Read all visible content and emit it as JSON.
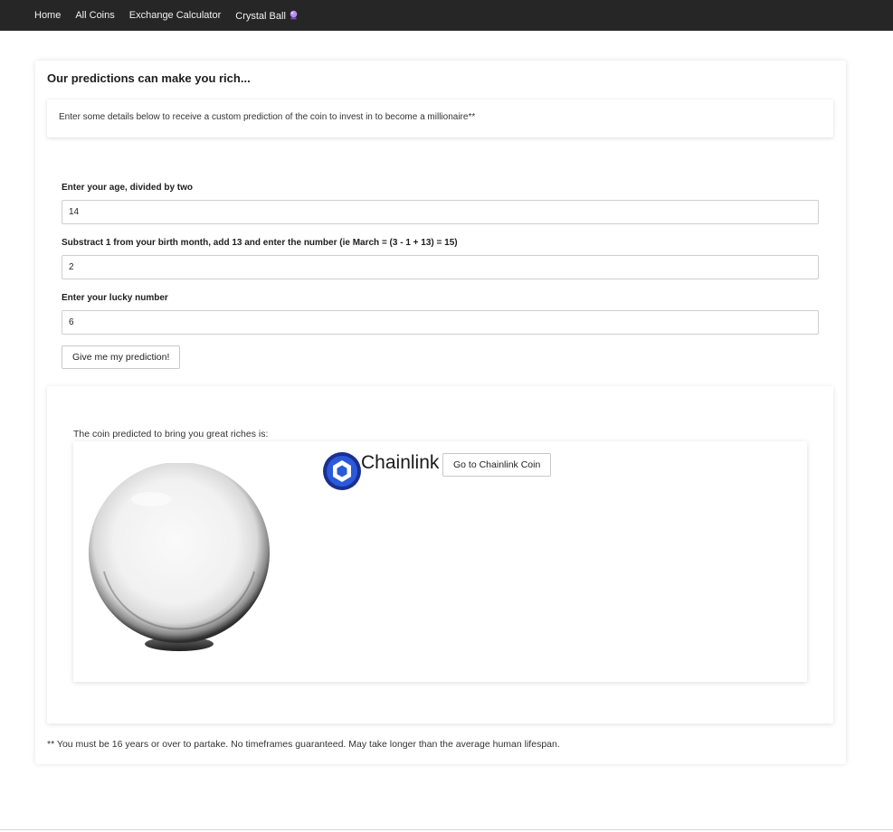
{
  "nav": {
    "items": [
      {
        "label": "Home"
      },
      {
        "label": "All Coins"
      },
      {
        "label": "Exchange Calculator"
      },
      {
        "label": "Crystal Ball",
        "icon": "crystal-ball-emoji"
      }
    ]
  },
  "main": {
    "heading": "Our predictions can make you rich...",
    "intro": "Enter some details below to receive a custom prediction of the coin to invest in to become a millionaire**"
  },
  "form": {
    "age": {
      "label": "Enter your age, divided by two",
      "value": "14"
    },
    "month": {
      "label": "Substract 1 from your birth month, add 13 and enter the number (ie March = (3 - 1 + 13) = 15)",
      "value": "2"
    },
    "lucky": {
      "label": "Enter your lucky number",
      "value": "6"
    },
    "submit_label": "Give me my prediction!"
  },
  "result": {
    "caption": "The coin predicted to bring you great riches is:",
    "coin_name": "Chainlink",
    "coin_icon": "chainlink-logo",
    "go_label": "Go to Chainlink Coin",
    "image": "crystal-ball-image"
  },
  "disclaimer": "** You must be 16 years or over to partake. No timeframes guaranteed. May take longer than the average human lifespan.",
  "colors": {
    "navbar": "#262626",
    "chainlink_blue": "#2A5ADA",
    "chainlink_dark": "#1B2F8E"
  }
}
